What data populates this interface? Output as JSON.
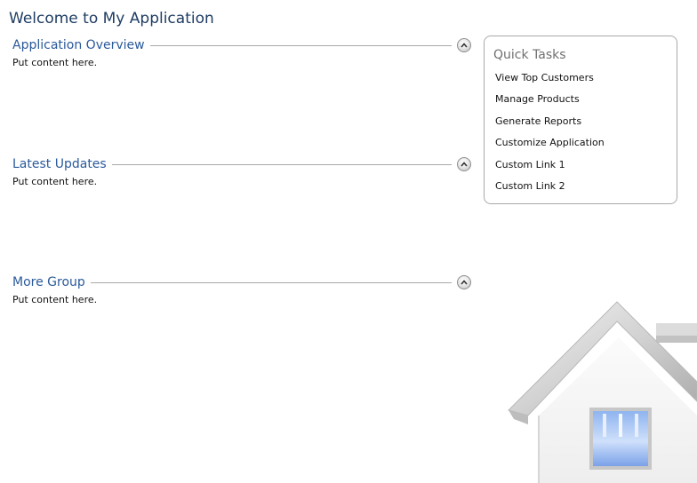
{
  "page": {
    "title": "Welcome to My Application"
  },
  "groups": [
    {
      "title": "Application Overview",
      "content": "Put content here.",
      "toggle_icon": "chevron-up-icon"
    },
    {
      "title": "Latest Updates",
      "content": "Put content here.",
      "toggle_icon": "chevron-up-icon"
    },
    {
      "title": "More Group",
      "content": "Put content here.",
      "toggle_icon": "chevron-up-icon"
    }
  ],
  "quick_tasks": {
    "title": "Quick Tasks",
    "items": [
      "View Top Customers",
      "Manage Products",
      "Generate Reports",
      "Customize Application",
      "Custom Link 1",
      "Custom Link 2"
    ]
  },
  "decoration": {
    "icon": "house-icon"
  },
  "colors": {
    "page_title": "#1f3d63",
    "group_title": "#2a5a9a",
    "quick_tasks_title": "#707070",
    "panel_border": "#a9a9a9"
  }
}
